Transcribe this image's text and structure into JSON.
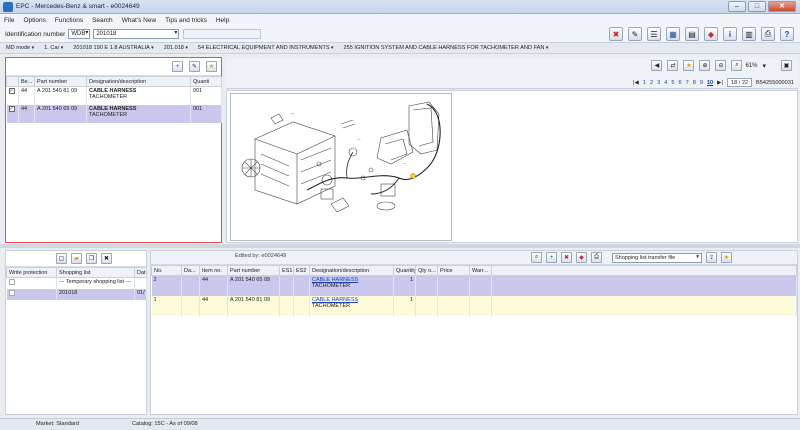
{
  "window": {
    "title": "EPC - Mercedes-Benz & smart - e0024649",
    "min": "–",
    "max": "□",
    "close": "✕"
  },
  "menu": [
    "File",
    "Options",
    "Functions",
    "Search",
    "What's New",
    "Tips and tricks",
    "Help"
  ],
  "ident": {
    "label": "Identification number",
    "type": "WDB",
    "value": "201018"
  },
  "nav": [
    "MD mode",
    "1. Car",
    "201018 190 E 1.8 AUSTRALIA",
    "201.018",
    "54 ELECTRICAL EQUIPMENT AND INSTRUMENTS",
    "255 IGNITION SYSTEM AND CABLE HARNESS FOR TACHOMETER AND FAN"
  ],
  "parts": {
    "headers": [
      "",
      "Be...",
      "Part number",
      "Designation/description",
      "Quanti"
    ],
    "rows": [
      {
        "checked": "✓",
        "be": "44",
        "part": "A 201 540 81 09",
        "desc": "CABLE HARNESS",
        "sub": "TACHOMETER",
        "qty": "001"
      },
      {
        "checked": "✓",
        "be": "44",
        "part": "A 201 540 65 09",
        "desc": "CABLE HARNESS",
        "sub": "TACHOMETER",
        "qty": "001"
      }
    ]
  },
  "viewer": {
    "zoom": "61%",
    "pages": [
      "1",
      "2",
      "3",
      "4",
      "5",
      "6",
      "7",
      "8",
      "9",
      "10"
    ],
    "current_page": "10",
    "page_count": "18 / 22",
    "doc_id": "B54255000031"
  },
  "shopping": {
    "headers": [
      "Write protection",
      "Shopping list",
      "Dat"
    ],
    "rows": [
      {
        "wp": "",
        "name": "--- Temporary shopping list ---",
        "date": ""
      },
      {
        "wp": "",
        "name": "201018",
        "date": "01/"
      }
    ]
  },
  "lower": {
    "edited": "Edited by: e0024649",
    "transfer": "Shopping list transfer file",
    "headers": [
      "No.",
      "Da...",
      "Item no.",
      "Part number",
      "ES1",
      "ES2",
      "Designation/description",
      "Quantity",
      "Qty o...",
      "Price",
      "Warr..."
    ],
    "rows": [
      {
        "no": "2",
        "item": "44",
        "part": "A 201 540 65 09",
        "desc": "CABLE HARNESS",
        "sub": "TACHOMETER",
        "qty": "1"
      },
      {
        "no": "1",
        "item": "44",
        "part": "A 201 540 81 09",
        "desc": "CABLE HARNESS",
        "sub": "TACHOMETER",
        "qty": "1"
      }
    ]
  },
  "status": {
    "market": "Market: Standard",
    "catalog": "Catalog: 15C - As of 09/08"
  }
}
